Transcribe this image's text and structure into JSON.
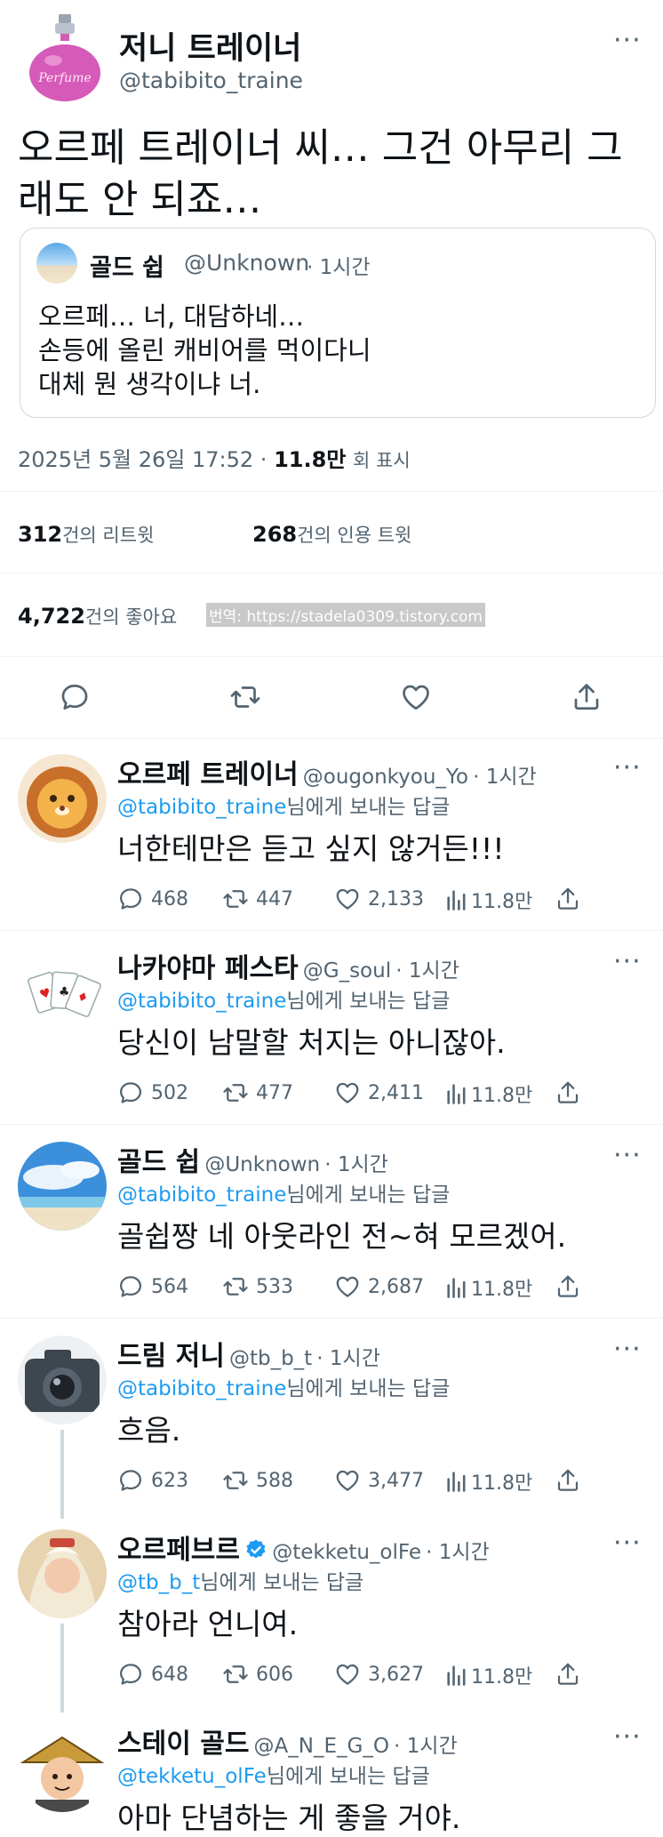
{
  "tweet": {
    "author_name": "저니 트레이너",
    "author_handle": "@tabibito_traine",
    "avatar_label": "Perfume",
    "text_line1": "오르페 트레이너 씨… 그건 아무리 그",
    "text_line2": "래도 안 되죠…",
    "quote": {
      "name": "골드 쉽",
      "handle": "@Unknown",
      "time": "· 1시간",
      "line1": "오르페… 너, 대담하네…",
      "line2": "손등에 올린 캐비어를 먹이다니",
      "line3": "대체 뭔 생각이냐 너."
    },
    "date": "2025년 5월 26일  17:52 ·",
    "views_num": "11.8만",
    "views_label": "회 표시",
    "retweets_num": "312",
    "retweets_label": "건의 리트윗",
    "quotes_num": "268",
    "quotes_label": "건의 인용 트윗",
    "likes_num": "4,722",
    "likes_label": "건의 좋아요",
    "watermark": "번역: https://stadela0309.tistory.com"
  },
  "icons": [
    "reply-icon",
    "retweet-icon",
    "like-icon",
    "share-icon",
    "views-icon",
    "more-icon",
    "verified-icon"
  ],
  "replies": [
    {
      "name": "오르페 트레이너",
      "handle": "@ougonkyou_Yo",
      "time": "· 1시간",
      "to": "@tabibito_traine",
      "to_suffix": "님에게 보내는 답글",
      "text": "너한테만은 듣고 싶지 않거든!!!",
      "replies": "468",
      "retweets": "447",
      "likes": "2,133",
      "views": "11.8만"
    },
    {
      "name": "나카야마 페스타",
      "handle": "@G_soul",
      "time": "· 1시간",
      "to": "@tabibito_traine",
      "to_suffix": "님에게 보내는 답글",
      "text": "당신이 남말할 처지는 아니잖아.",
      "replies": "502",
      "retweets": "477",
      "likes": "2,411",
      "views": "11.8만"
    },
    {
      "name": "골드 쉽",
      "handle": "@Unknown",
      "time": "· 1시간",
      "to": "@tabibito_traine",
      "to_suffix": "님에게 보내는 답글",
      "text": "골쉽짱 네 아웃라인 전~혀 모르겠어.",
      "replies": "564",
      "retweets": "533",
      "likes": "2,687",
      "views": "11.8만"
    },
    {
      "name": "드림 저니",
      "handle": "@tb_b_t",
      "time": "· 1시간",
      "to": "@tabibito_traine",
      "to_suffix": "님에게 보내는 답글",
      "text": "흐음.",
      "replies": "623",
      "retweets": "588",
      "likes": "3,477",
      "views": "11.8만"
    },
    {
      "name": "오르페브르",
      "handle": "@tekketu_olFe",
      "time": "· 1시간",
      "to": "@tb_b_t",
      "to_suffix": "님에게 보내는 답글",
      "text": "참아라 언니여.",
      "replies": "648",
      "retweets": "606",
      "likes": "3,627",
      "views": "11.8만"
    },
    {
      "name": "스테이 골드",
      "handle": "@A_N_E_G_O",
      "time": "· 1시간",
      "to": "@tekketu_olFe",
      "to_suffix": "님에게 보내는 답글",
      "text": "아마 단념하는 게 좋을 거야."
    }
  ]
}
